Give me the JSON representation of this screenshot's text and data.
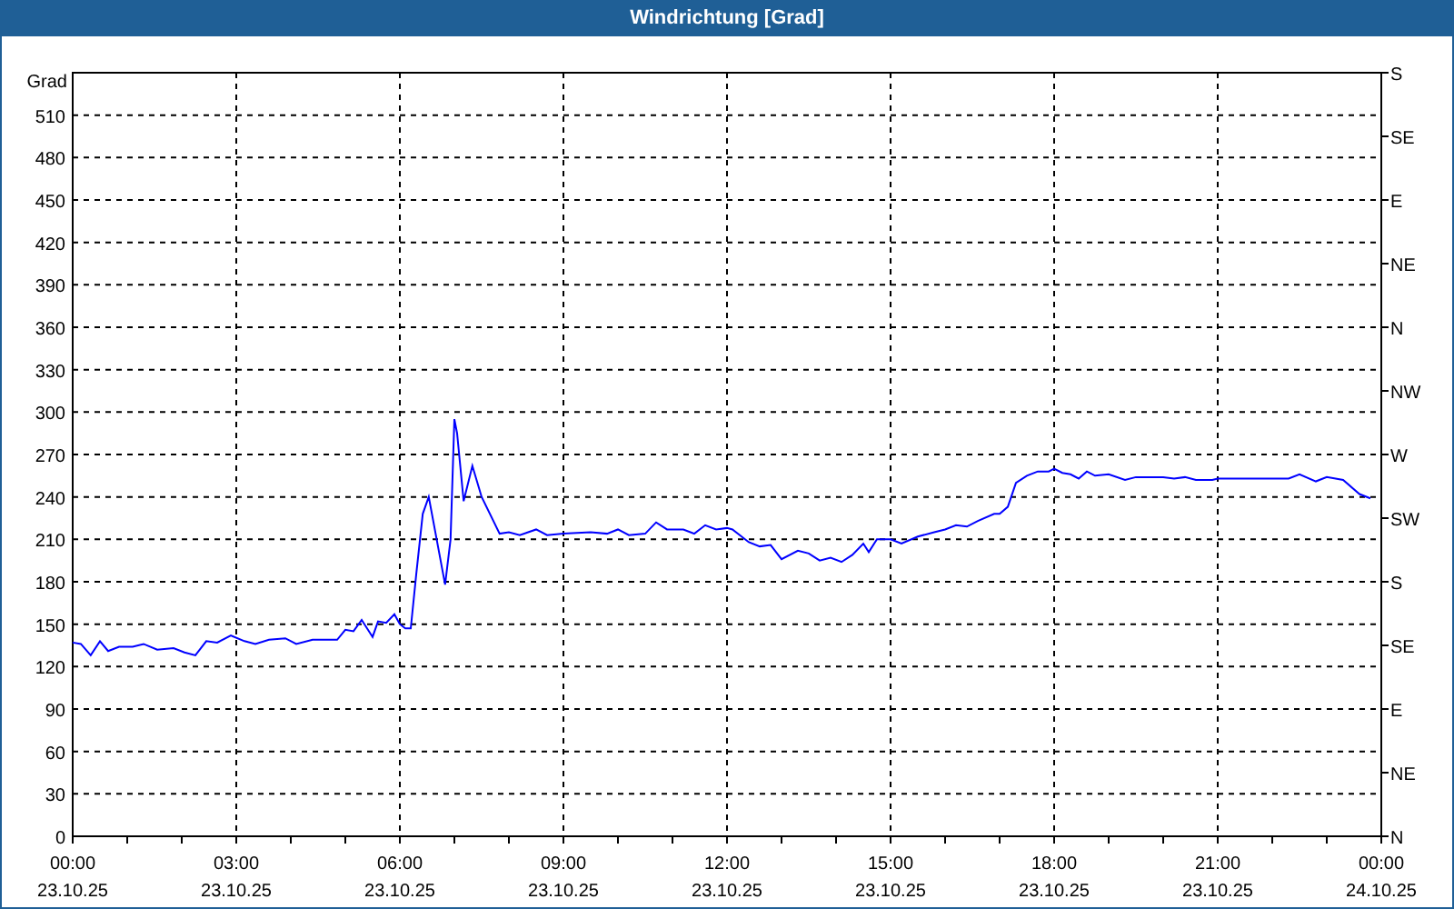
{
  "window": {
    "title": "Windrichtung [Grad]"
  },
  "chart": {
    "x_dates": [
      "23.10.25",
      "23.10.25",
      "23.10.25",
      "23.10.25",
      "23.10.25",
      "23.10.25",
      "23.10.25",
      "23.10.25",
      "24.10.25"
    ],
    "right_axis": [
      "S",
      "SE",
      "E",
      "NE",
      "N",
      "NW",
      "W",
      "SW",
      "S",
      "SE",
      "E",
      "NE",
      "N"
    ],
    "chart_data": {
      "type": "line",
      "grid": true,
      "ylabel": "Grad",
      "xlim": [
        0,
        24
      ],
      "ylim": [
        0,
        540
      ],
      "yticks": [
        0,
        30,
        60,
        90,
        120,
        150,
        180,
        210,
        240,
        270,
        300,
        330,
        360,
        390,
        420,
        450,
        480,
        510
      ],
      "xticks": [
        {
          "value": 0,
          "label": "00:00"
        },
        {
          "value": 3,
          "label": "03:00"
        },
        {
          "value": 6,
          "label": "06:00"
        },
        {
          "value": 9,
          "label": "09:00"
        },
        {
          "value": 12,
          "label": "12:00"
        },
        {
          "value": 15,
          "label": "15:00"
        },
        {
          "value": 18,
          "label": "18:00"
        },
        {
          "value": 21,
          "label": "21:00"
        },
        {
          "value": 24,
          "label": "00:00"
        }
      ],
      "x": [
        0,
        0.15,
        0.33,
        0.5,
        0.65,
        0.85,
        1.1,
        1.3,
        1.55,
        1.85,
        2.05,
        2.25,
        2.45,
        2.65,
        2.9,
        3.15,
        3.35,
        3.6,
        3.9,
        4.1,
        4.4,
        4.85,
        5.0,
        5.15,
        5.3,
        5.5,
        5.6,
        5.75,
        5.9,
        6.0,
        6.1,
        6.2,
        6.3,
        6.42,
        6.53,
        6.83,
        6.93,
        7.0,
        7.05,
        7.17,
        7.33,
        7.5,
        7.83,
        8.0,
        8.2,
        8.5,
        8.7,
        9.0,
        9.5,
        9.8,
        10.0,
        10.2,
        10.5,
        10.7,
        10.9,
        11.2,
        11.4,
        11.6,
        11.8,
        12.0,
        12.1,
        12.4,
        12.6,
        12.8,
        13.0,
        13.3,
        13.5,
        13.7,
        13.9,
        14.1,
        14.3,
        14.5,
        14.6,
        14.75,
        15.0,
        15.2,
        15.5,
        15.8,
        16.0,
        16.2,
        16.4,
        16.6,
        16.9,
        17.0,
        17.15,
        17.3,
        17.5,
        17.7,
        17.9,
        18.0,
        18.15,
        18.3,
        18.45,
        18.6,
        18.75,
        19.0,
        19.3,
        19.5,
        19.8,
        20.0,
        20.2,
        20.4,
        20.6,
        20.9,
        21.0,
        21.5,
        22.0,
        22.3,
        22.5,
        22.8,
        23.0,
        23.3,
        23.6,
        23.8
      ],
      "series": [
        {
          "color": "#0000ff",
          "values": [
            137,
            136,
            128,
            138,
            131,
            134,
            134,
            136,
            132,
            133,
            130,
            128,
            138,
            137,
            142,
            138,
            136,
            139,
            140,
            136,
            139,
            139,
            146,
            145,
            153,
            141,
            152,
            151,
            157,
            150,
            147,
            147,
            185,
            228,
            240,
            178,
            210,
            295,
            285,
            237,
            262,
            240,
            214,
            215,
            213,
            217,
            213,
            214,
            215,
            214,
            217,
            213,
            214,
            222,
            217,
            217,
            214,
            220,
            217,
            218,
            217,
            208,
            205,
            206,
            196,
            202,
            200,
            195,
            197,
            194,
            199,
            207,
            201,
            210,
            210,
            207,
            212,
            215,
            217,
            220,
            219,
            223,
            228,
            228,
            233,
            250,
            255,
            258,
            258,
            260,
            257,
            256,
            253,
            258,
            255,
            256,
            252,
            254,
            254,
            254,
            253,
            254,
            252,
            252,
            253,
            253,
            253,
            253,
            256,
            251,
            254,
            252,
            242,
            239
          ]
        }
      ]
    }
  }
}
